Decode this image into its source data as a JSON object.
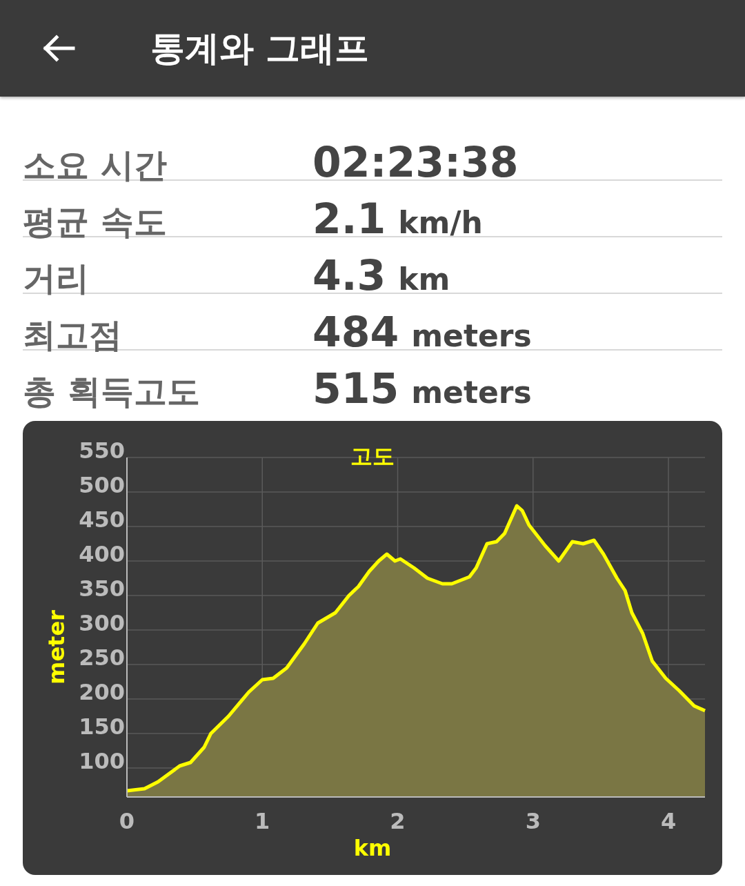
{
  "header": {
    "title": "통계와 그래프"
  },
  "stats": [
    {
      "label": "소요 시간",
      "value": "02:23:38"
    },
    {
      "label": "평균 속도",
      "value": "2.1",
      "unit": "km/h"
    },
    {
      "label": "거리",
      "value": "4.3",
      "unit": "km"
    },
    {
      "label": "최고점",
      "value": "484",
      "unit": "meters"
    },
    {
      "label": "총 획득고도",
      "value": "515",
      "unit": "meters"
    }
  ],
  "chart": {
    "chart_data": {
      "type": "area",
      "grid": true,
      "xlabel": "km",
      "ylabel": "meter",
      "xlim": [
        0,
        4.27
      ],
      "ylim": [
        58,
        550
      ],
      "xticks": [
        0,
        1,
        2,
        3,
        4
      ],
      "yticks": [
        100,
        150,
        200,
        250,
        300,
        350,
        400,
        450,
        500,
        550
      ],
      "x": [
        0,
        0.13,
        0.23,
        0.39,
        0.47,
        0.57,
        0.62,
        0.75,
        0.9,
        1.0,
        1.08,
        1.18,
        1.31,
        1.41,
        1.54,
        1.64,
        1.71,
        1.79,
        1.86,
        1.92,
        1.98,
        2.02,
        2.12,
        2.22,
        2.33,
        2.4,
        2.53,
        2.58,
        2.66,
        2.73,
        2.79,
        2.88,
        2.92,
        2.97,
        3.09,
        3.19,
        3.29,
        3.37,
        3.45,
        3.52,
        3.62,
        3.68,
        3.73,
        3.81,
        3.88,
        3.98,
        4.08,
        4.19,
        4.27
      ],
      "series": [
        {
          "name": "고도",
          "color": "#ffff00",
          "values": [
            67,
            70,
            80,
            103,
            108,
            130,
            150,
            175,
            210,
            228,
            230,
            245,
            280,
            310,
            325,
            350,
            363,
            385,
            400,
            410,
            400,
            403,
            390,
            375,
            367,
            367,
            377,
            390,
            425,
            428,
            440,
            480,
            473,
            452,
            422,
            400,
            428,
            425,
            430,
            410,
            375,
            357,
            325,
            295,
            255,
            230,
            212,
            190,
            183
          ]
        }
      ]
    }
  }
}
